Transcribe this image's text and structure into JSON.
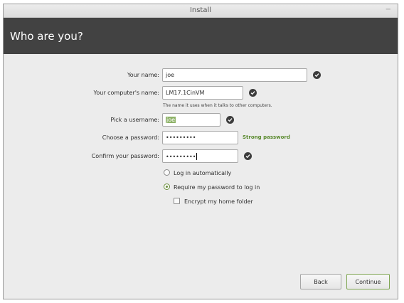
{
  "window": {
    "title": "Install",
    "minimize_glyph": "−"
  },
  "header": {
    "title": "Who are you?"
  },
  "form": {
    "name": {
      "label": "Your name:",
      "value": "joe"
    },
    "computer": {
      "label": "Your computer's name:",
      "value": "LM17.1CinVM",
      "hint": "The name it uses when it talks to other computers."
    },
    "username": {
      "label": "Pick a username:",
      "value": "joe"
    },
    "password": {
      "label": "Choose a password:",
      "value": "•••••••••",
      "strength": "Strong password"
    },
    "confirm": {
      "label": "Confirm your password:",
      "value": "•••••••••"
    }
  },
  "login_options": {
    "auto": {
      "label": "Log in automatically",
      "selected": false
    },
    "require": {
      "label": "Require my password to log in",
      "selected": true
    },
    "encrypt": {
      "label": "Encrypt my home folder",
      "checked": false
    }
  },
  "buttons": {
    "back": "Back",
    "continue": "Continue"
  },
  "icons": {
    "valid": "check-circle-icon"
  },
  "colors": {
    "header_bg": "#424242",
    "accent": "#6b8f3d",
    "strength": "#5a8a2e"
  }
}
